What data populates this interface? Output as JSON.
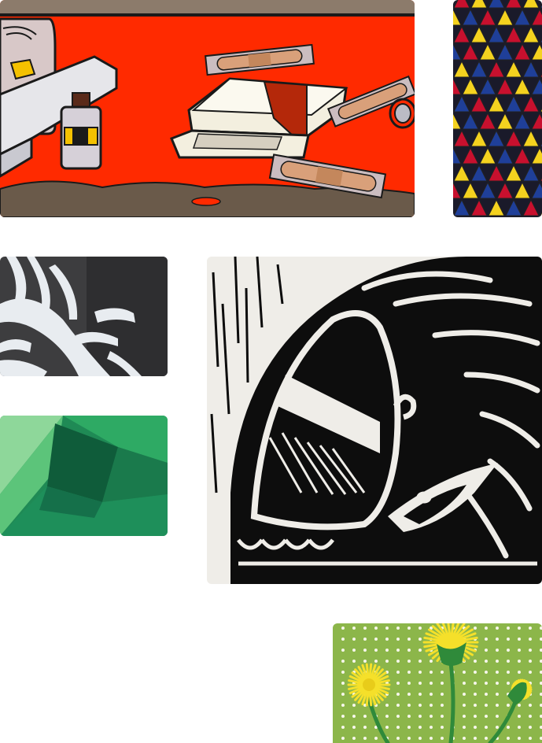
{
  "gallery": {
    "tiles": [
      {
        "id": "firstaid",
        "subject": "first-aid-kit-illustration"
      },
      {
        "id": "crochet",
        "subject": "crochet-granny-stitch"
      },
      {
        "id": "papercut",
        "subject": "white-papercut-leaves"
      },
      {
        "id": "quilt",
        "subject": "green-fabric-quilt"
      },
      {
        "id": "linocut",
        "subject": "linocut-bird-print"
      },
      {
        "id": "embroidery",
        "subject": "dandelion-embroidery"
      }
    ]
  },
  "colors": {
    "illustration_red": "#ff2a00",
    "illustration_band": "#8c7b6b",
    "crochet_red": "#c8102e",
    "crochet_yellow": "#f4d21f",
    "crochet_blue": "#1f3f99",
    "papercut_bg": "#3d3d3f",
    "quilt_green": "#1f8a55",
    "lino_ink": "#0d0d0d",
    "lino_paper": "#efede8",
    "embroidery_bg": "#8cb64a",
    "embroidery_yellow": "#f5e02a"
  }
}
